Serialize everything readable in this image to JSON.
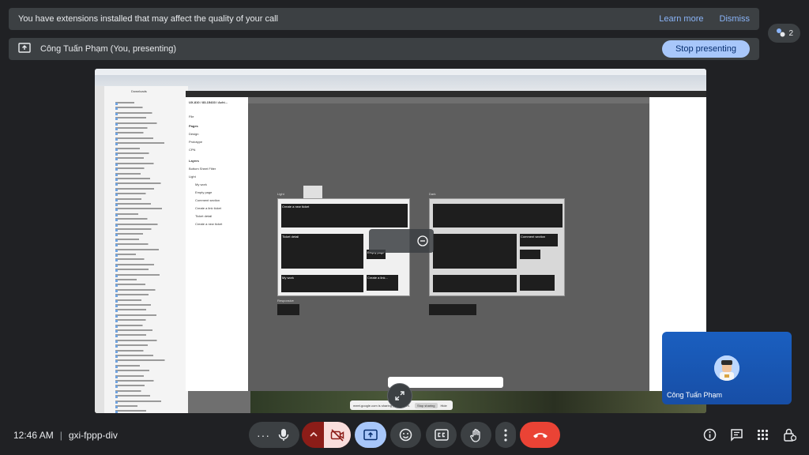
{
  "banner": {
    "message": "You have extensions installed that may affect the quality of your call",
    "learn_more": "Learn more",
    "dismiss": "Dismiss"
  },
  "presenting": {
    "presenter": "Công Tuấn Phạm (You, presenting)",
    "stop_label": "Stop presenting"
  },
  "participants": {
    "count": "2"
  },
  "shared_screen": {
    "downloads_title": "Downloads",
    "file_title": "UX-810 / 83-15433 / Achi...",
    "tabs_file": "File",
    "pages_label": "Pages",
    "pages": [
      "Design",
      "Prototype",
      "CPN"
    ],
    "layers_label": "Layers",
    "layers": [
      "Bottom Sheet Filter",
      "Light",
      "My work",
      "Empty page",
      "Comment section",
      "Create a link ticket",
      "Ticket detail",
      "Create a new ticket"
    ],
    "frame_light": "Light",
    "frame_dark": "Dark",
    "frame_create": "Create a new ticket",
    "frame_detail": "Ticket detail",
    "frame_comment": "Comment section",
    "frame_empty": "Empty page",
    "frame_mywork": "My work",
    "frame_link": "Create a link...",
    "frame_responsive": "Responsive",
    "share_text": "meet.google.com is sharing your screen.",
    "share_stop": "Stop sharing",
    "share_hide": "Hide"
  },
  "self_view": {
    "name": "Công Tuấn Phạm"
  },
  "footer": {
    "time": "12:46 AM",
    "meeting_code": "gxi-fppp-div"
  },
  "icons": {
    "extension": "puzzle-icon",
    "present": "present-screen-icon",
    "expand": "expand-icon",
    "mic": "mic-icon",
    "camera_off": "camera-off-icon",
    "present_now": "present-to-all-icon",
    "emoji": "emoji-icon",
    "captions": "captions-icon",
    "hand": "raise-hand-icon",
    "more": "more-vert-icon",
    "hangup": "call-end-icon",
    "info": "info-icon",
    "chat": "chat-icon",
    "activities": "apps-icon",
    "host": "host-controls-icon"
  },
  "colors": {
    "accent": "#a8c7fa",
    "hangup": "#ea4335",
    "camera_off": "#f9dedc"
  }
}
